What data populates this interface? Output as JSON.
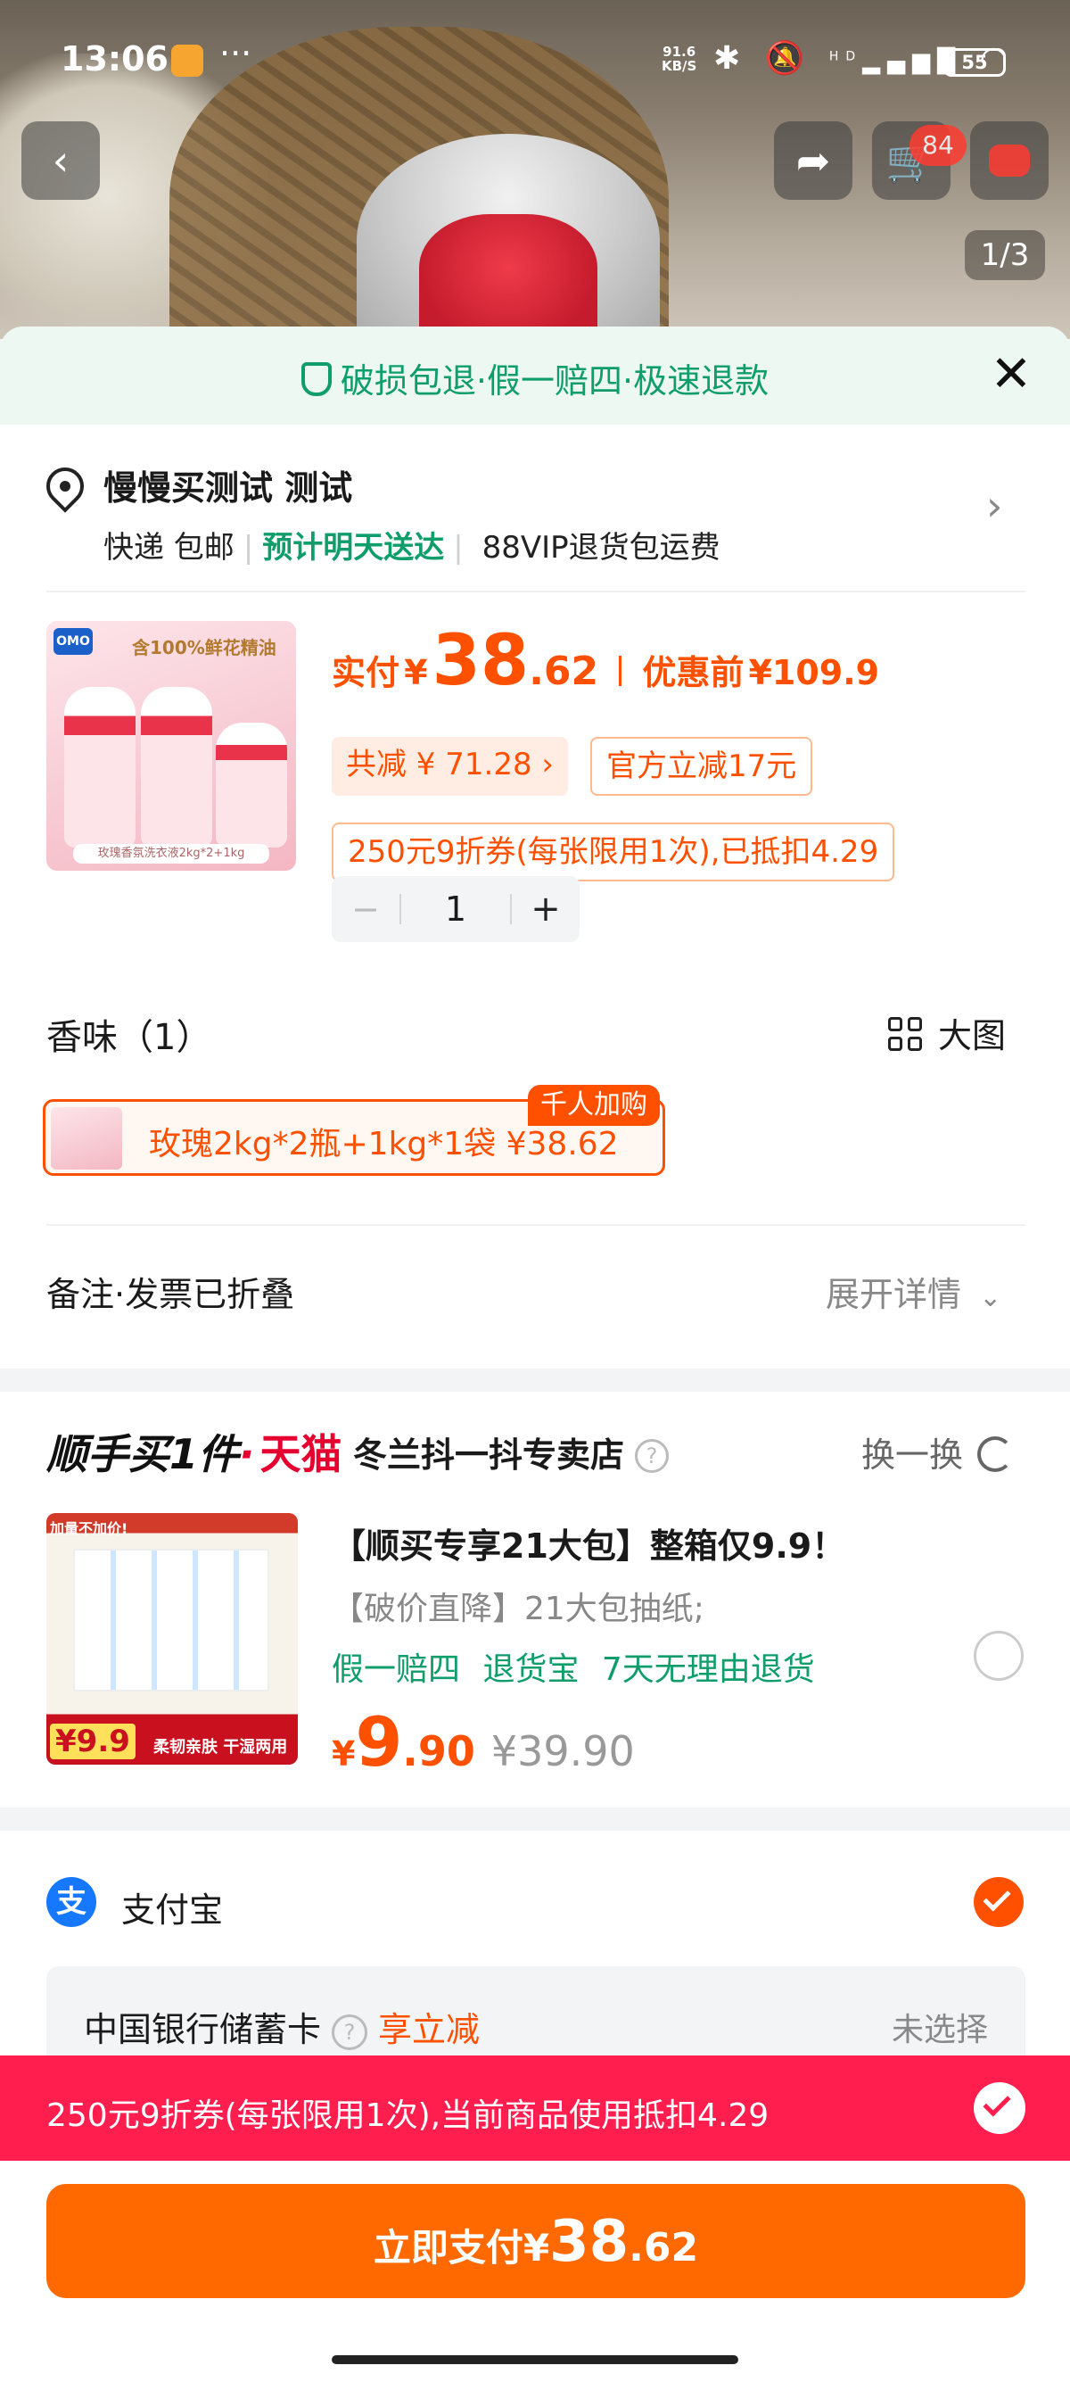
{
  "status_bar": {
    "time": "13:06",
    "more": "···",
    "net_speed_value": "91.6",
    "net_speed_unit": "KB/S",
    "hd": "HD",
    "battery": "55"
  },
  "header": {
    "cart_badge": "84",
    "image_index": "1/3"
  },
  "promise_bar": {
    "text": "破损包退·假一赔四·极速退款"
  },
  "address": {
    "name": "慢慢买测试 测试",
    "shipping": "快递 包邮",
    "eta": "预计明天送达",
    "vip": "88VIP退货包运费"
  },
  "product": {
    "thumb_tag": "含100%鲜花精油",
    "thumb_brand": "OMO",
    "thumb_footer": "玫瑰香氛洗衣液2kg*2+1kg",
    "paid_label": "实付",
    "yen": "¥",
    "price_int": "38",
    "price_dec": ".62",
    "before_label": "优惠前",
    "before_price": "¥109.9",
    "save_chip": "共减 ¥ 71.28 ›",
    "official_chip": "官方立减17元",
    "coupon_chip": "250元9折券(每张限用1次),已抵扣4.29",
    "qty_minus": "−",
    "qty_value": "1",
    "qty_plus": "+"
  },
  "scent": {
    "title": "香味（1）",
    "big_view": "大图",
    "option_text": "玫瑰2kg*2瓶+1kg*1袋 ¥38.62",
    "option_badge": "千人加购"
  },
  "remark": {
    "label": "备注·发票已折叠",
    "expand": "展开详情"
  },
  "recommend": {
    "logo": "顺手买1件",
    "dot": "·",
    "tmall": "天猫",
    "store": "冬兰抖一抖专卖店",
    "help": "?",
    "swap": "换一换",
    "thumb_badge": "加量不加价!",
    "thumb_price": "¥9.9",
    "thumb_footer": "柔韧亲肤 干湿两用",
    "title": "【顺买专享21大包】整箱仅9.9！",
    "subtitle": "【破价直降】21大包抽纸;",
    "tags": "假一赔四 退货宝 7天无理由退货",
    "yen": "¥",
    "price_int": "9",
    "price_dec": ".90",
    "orig_price": "¥39.90"
  },
  "payment": {
    "alipay_glyph": "支",
    "alipay_label": "支付宝",
    "bank_name": "中国银行储蓄卡",
    "bank_help": "?",
    "bank_promo": "享立减",
    "bank_state": "未选择",
    "coupon_text": "250元9折券(每张限用1次),当前商品使用抵扣4.29"
  },
  "footer": {
    "pay_label": "立即支付",
    "yen": "¥",
    "price_int": "38",
    "price_dec": ".62"
  },
  "colors": {
    "accent": "#ff5000",
    "green": "#0f9d6b",
    "coupon_bar": "#ff1e4e",
    "alipay": "#1677ff"
  },
  "icons": [
    "back-icon",
    "share-icon",
    "cart-icon",
    "message-icon",
    "shield-check-icon",
    "close-icon",
    "location-pin-icon",
    "chevron-right-icon",
    "grid-icon",
    "chevron-down-icon",
    "help-icon",
    "refresh-icon",
    "radio-icon",
    "alipay-icon",
    "check-icon"
  ]
}
